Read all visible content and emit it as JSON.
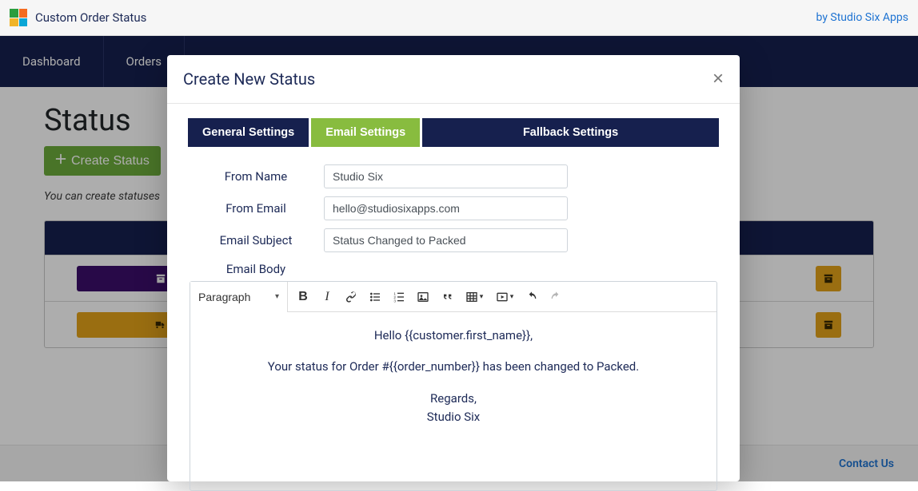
{
  "header": {
    "app_title": "Custom Order Status",
    "by_text": "by Studio Six Apps"
  },
  "nav": {
    "items": [
      "Dashboard",
      "Orders"
    ]
  },
  "page": {
    "heading": "Status",
    "create_button": "Create Status",
    "hint": "You can create statuses"
  },
  "footer": {
    "contact": "Contact Us"
  },
  "modal": {
    "title": "Create New Status",
    "tabs": {
      "general": "General Settings",
      "email": "Email Settings",
      "fallback": "Fallback Settings"
    },
    "labels": {
      "from_name": "From Name",
      "from_email": "From Email",
      "subject": "Email Subject",
      "body": "Email Body"
    },
    "form": {
      "from_name": "Studio Six",
      "from_email": "hello@studiosixapps.com",
      "subject": "Status Changed to Packed"
    },
    "editor": {
      "format_label": "Paragraph",
      "body_lines": {
        "greeting": "Hello {{customer.first_name}},",
        "main": "Your status for Order #{{order_number}} has been changed to Packed.",
        "regards": "Regards,",
        "signature": "Studio Six"
      }
    }
  }
}
